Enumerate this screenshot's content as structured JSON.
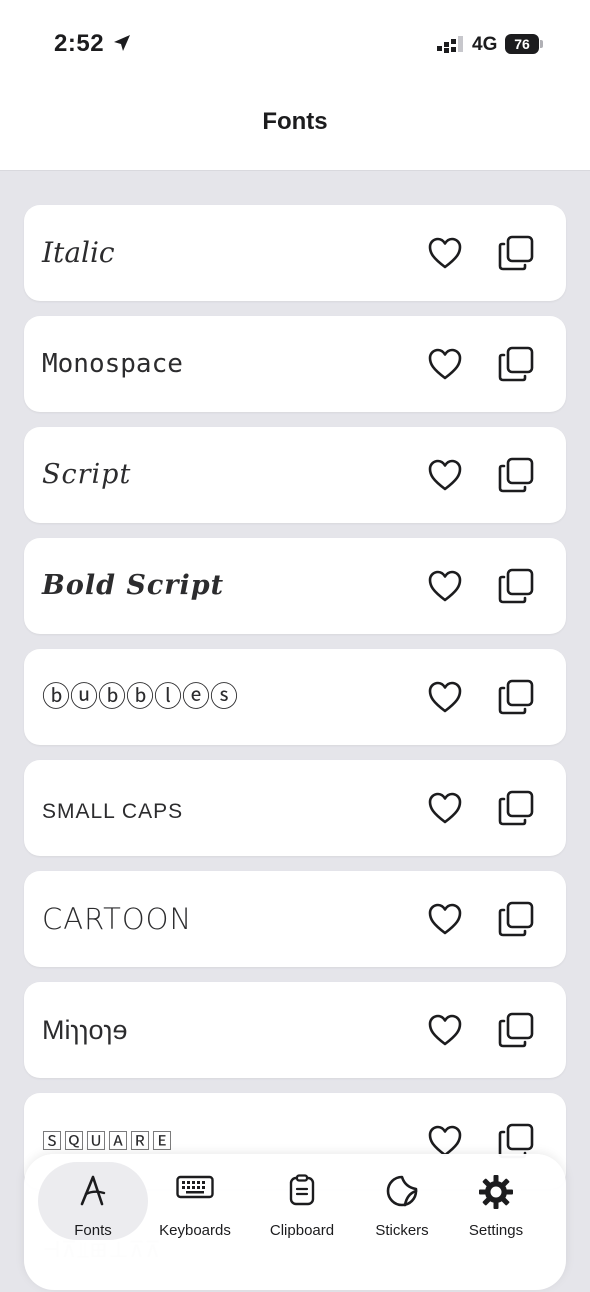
{
  "status": {
    "time": "2:52",
    "network": "4G",
    "battery": "76"
  },
  "header": {
    "title": "Fonts"
  },
  "fonts": [
    {
      "label": "Italic",
      "style": "italic"
    },
    {
      "label": "Monospace",
      "style": "mono"
    },
    {
      "label": "Script",
      "style": "script"
    },
    {
      "label": "Bold Script",
      "style": "boldscript"
    },
    {
      "label": "ⓑⓤⓑⓑⓛⓔⓢ",
      "style": "bubbles"
    },
    {
      "label": "SMALL CAPS",
      "style": "smallcaps"
    },
    {
      "label": "CARTOON",
      "style": "cartoon"
    },
    {
      "label": "Miɿɿoɿɘ",
      "style": "mirror"
    },
    {
      "label": "🅂🅀🅄🄰🅁🄴",
      "style": "square"
    }
  ],
  "tabs": [
    {
      "label": "Fonts",
      "icon": "fonts-icon"
    },
    {
      "label": "Keyboards",
      "icon": "keyboard-icon"
    },
    {
      "label": "Clipboard",
      "icon": "clipboard-icon"
    },
    {
      "label": "Stickers",
      "icon": "sticker-icon"
    },
    {
      "label": "Settings",
      "icon": "gear-icon"
    }
  ],
  "active_tab": "Fonts",
  "colors": {
    "background": "#e5e5ea",
    "card": "#ffffff",
    "text": "#1c1c1e"
  }
}
